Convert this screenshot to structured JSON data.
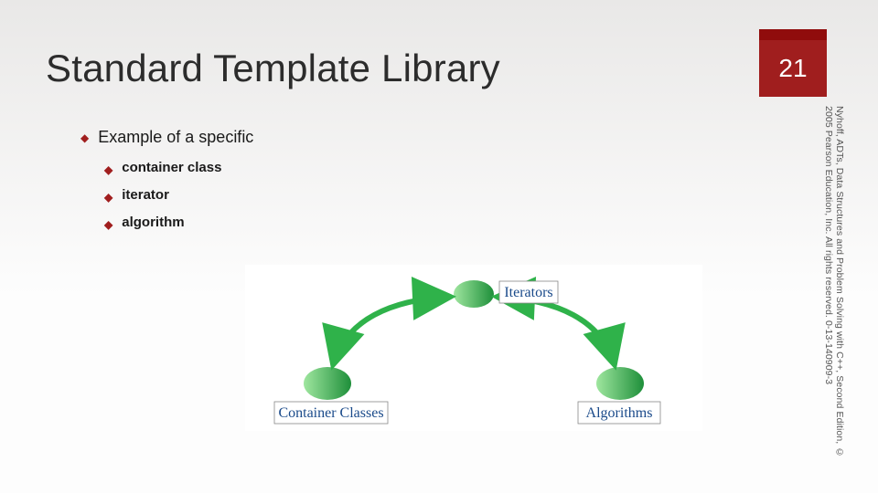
{
  "title": "Standard Template Library",
  "page_number": "21",
  "main_bullet": "Example of a specific",
  "sub_bullets": [
    "container class",
    "iterator",
    "algorithm"
  ],
  "figure": {
    "top_label": "Iterators",
    "left_label": "Container Classes",
    "right_label": "Algorithms"
  },
  "copyright": "Nyhoff, ADTs, Data Structures and Problem Solving with C++, Second Edition, © 2005 Pearson Education, Inc. All rights reserved. 0-13-140909-3"
}
